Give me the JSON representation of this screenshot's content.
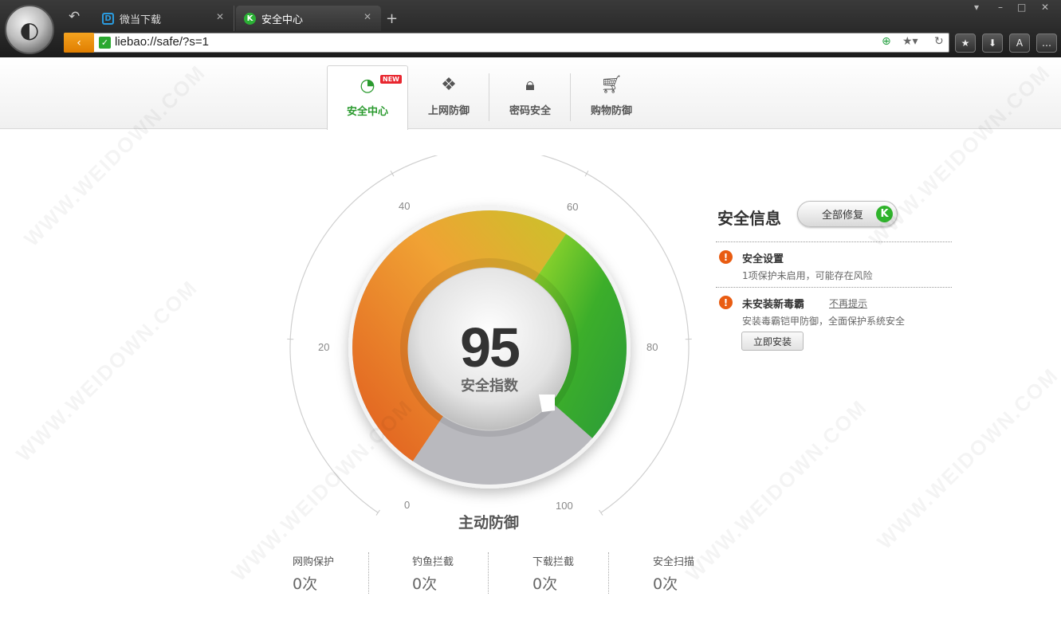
{
  "browser": {
    "logo_icon": "cheetah-logo-icon",
    "tabs": [
      {
        "title": "微当下载",
        "icon": "D"
      },
      {
        "title": "安全中心",
        "icon": "K"
      }
    ],
    "url": "liebao://safe/?s=1",
    "new_tab": "+",
    "back_arrow": "‹",
    "win_min": "–",
    "win_max": "□",
    "win_close": "✕",
    "skin": "👕",
    "toolbar": {
      "star": "★",
      "download": "⬇",
      "account": "A",
      "more": "…"
    }
  },
  "nav": {
    "tabs": [
      {
        "label": "安全中心",
        "icon": "speedometer-icon",
        "badge": "NEW"
      },
      {
        "label": "上网防御",
        "icon": "shield-leaf-icon"
      },
      {
        "label": "密码安全",
        "icon": "lock-icon"
      },
      {
        "label": "购物防御",
        "icon": "cart-icon"
      }
    ]
  },
  "gauge": {
    "score": "95",
    "score_label": "安全指数",
    "section_label": "主动防御",
    "ticks": [
      "0",
      "20",
      "40",
      "60",
      "80",
      "100"
    ],
    "value": 95,
    "colors": {
      "orange": "#e86a20",
      "green": "#2aa32a",
      "lightgreen": "#8ddc2a",
      "gray": "#b8b8bd"
    }
  },
  "stats": [
    {
      "label": "网购保护",
      "value": "0次"
    },
    {
      "label": "钓鱼拦截",
      "value": "0次"
    },
    {
      "label": "下载拦截",
      "value": "0次"
    },
    {
      "label": "安全扫描",
      "value": "0次"
    }
  ],
  "security": {
    "title": "安全信息",
    "fix_all": "全部修复",
    "fix_badge": "K",
    "items": [
      {
        "title": "安全设置",
        "desc": "1项保护未启用，可能存在风险"
      },
      {
        "title": "未安装新毒霸",
        "dismiss": "不再提示",
        "desc": "安装毒霸铠甲防御，全面保护系统安全",
        "action": "立即安装"
      }
    ]
  },
  "watermark": "WWW.WEIDOWN.COM"
}
